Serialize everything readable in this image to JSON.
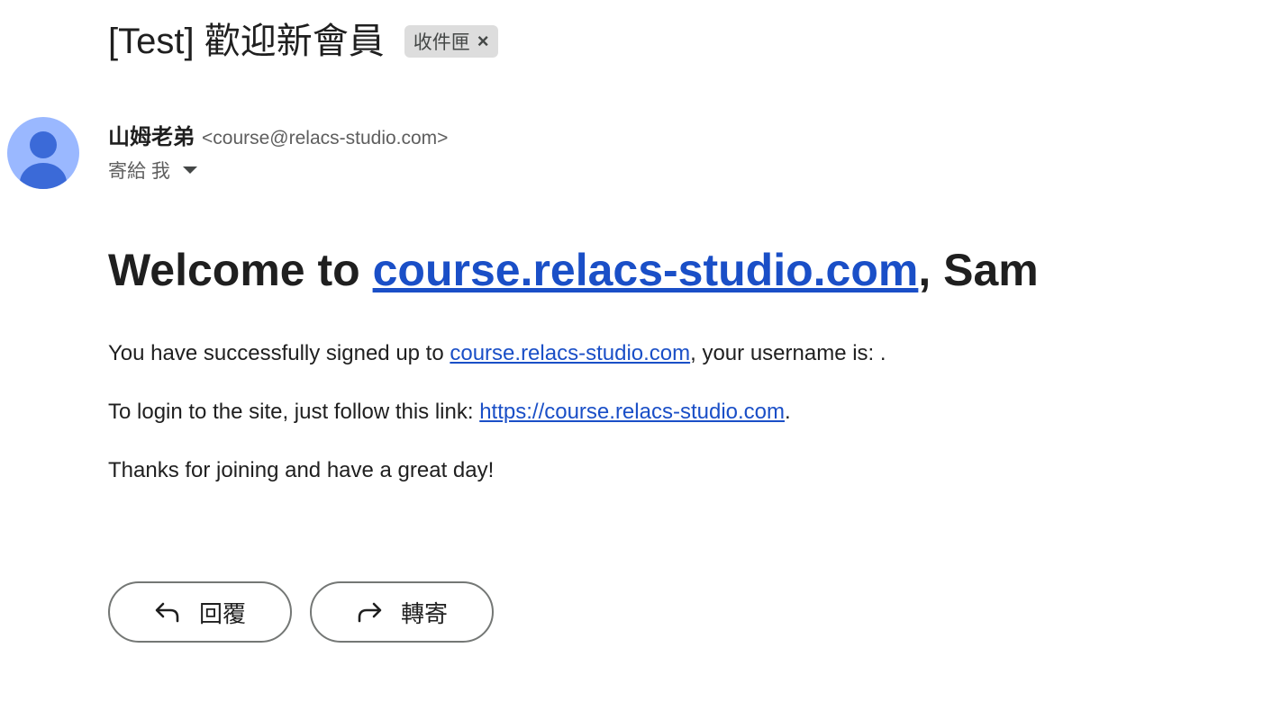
{
  "email": {
    "subject": "[Test] 歡迎新會員",
    "label_chip": "收件匣",
    "label_chip_close_glyph": "×",
    "sender_name": "山姆老弟",
    "sender_email": "<course@relacs-studio.com>",
    "to_text": "寄給 我"
  },
  "body": {
    "heading_prefix": "Welcome to ",
    "heading_link": "course.relacs-studio.com",
    "heading_suffix": ", Sam",
    "para1_prefix": "You have successfully signed up to ",
    "para1_link": "course.relacs-studio.com",
    "para1_suffix": ", your username is: .",
    "para2_prefix": "To login to the site, just follow this link: ",
    "para2_link": "https://course.relacs-studio.com",
    "para2_suffix": ".",
    "para3": "Thanks for joining and have a great day!"
  },
  "actions": {
    "reply_label": "回覆",
    "forward_label": "轉寄",
    "reply_icon": "reply-icon",
    "forward_icon": "forward-icon"
  },
  "colors": {
    "link": "#1a4fc7",
    "avatar_bg": "#9ab8ff",
    "avatar_fg": "#3b6ad8",
    "chip_bg": "#dddddd"
  }
}
